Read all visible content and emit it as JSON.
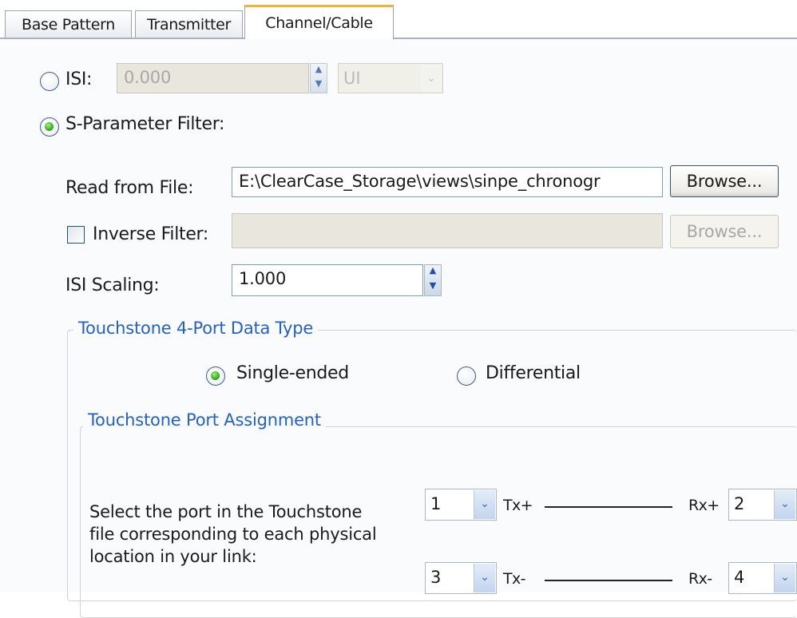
{
  "tabs": [
    "Base Pattern",
    "Transmitter",
    "Channel/Cable"
  ],
  "isi": {
    "label": "ISI:",
    "value": "0.000",
    "unit": "UI",
    "selected": false
  },
  "sparam": {
    "label": "S-Parameter Filter:",
    "selected": true,
    "read_label": "Read from File:",
    "file_path": "E:\\ClearCase_Storage\\views\\sinpe_chronogr",
    "browse": "Browse...",
    "inverse_label": "Inverse Filter:",
    "inverse_checked": false,
    "inverse_path": "",
    "inverse_browse": "Browse...",
    "scaling_label": "ISI Scaling:",
    "scaling_value": "1.000"
  },
  "data_type": {
    "title": "Touchstone 4-Port Data Type",
    "single_label": "Single-ended",
    "diff_label": "Differential",
    "selected": "Single-ended"
  },
  "port_assign": {
    "title": "Touchstone Port Assignment",
    "note_lines": [
      "Select the port in the Touchstone",
      "file corresponding to each physical",
      "location in your link:"
    ],
    "rows": [
      {
        "tx_port": "1",
        "tx_label": "Tx+",
        "rx_label": "Rx+",
        "rx_port": "2"
      },
      {
        "tx_port": "3",
        "tx_label": "Tx-",
        "rx_label": "Rx-",
        "rx_port": "4"
      }
    ]
  },
  "icons": {
    "combo_arrow": "chevron-down-icon",
    "spin_up": "spin-up-icon",
    "spin_down": "spin-down-icon"
  },
  "colors": {
    "active_tab_accent": "#f2b23a",
    "group_title": "#2361c4",
    "radio_selected": "#29a414"
  }
}
